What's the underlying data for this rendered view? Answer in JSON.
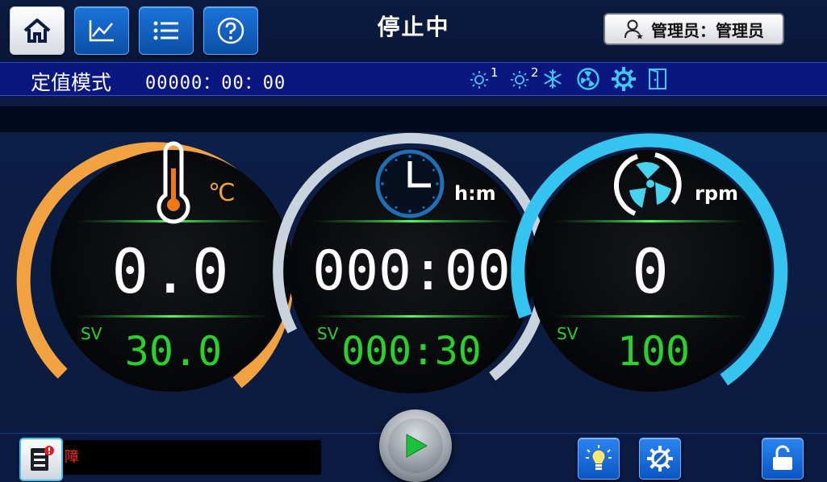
{
  "header": {
    "status": "停止中",
    "user_label": "管理员：管理员",
    "nav": [
      "home-icon",
      "chart-icon",
      "list-icon",
      "help-icon"
    ]
  },
  "mode_bar": {
    "mode": "定值模式",
    "timer": "00000：00：00",
    "light1_index": "1",
    "light2_index": "2"
  },
  "gauges": {
    "temperature": {
      "unit": "℃",
      "pv": "0.0",
      "sv_label": "SV",
      "sv": "30.0",
      "ring_color": "#f2a240"
    },
    "time": {
      "unit": "h:m",
      "pv": "000:00",
      "sv_label": "SV",
      "sv": "000:30",
      "ring_color": "#c9d3de"
    },
    "speed": {
      "unit": "rpm",
      "pv": "0",
      "sv_label": "SV",
      "sv": "100",
      "ring_color": "#35c4ef"
    }
  },
  "footer": {
    "alarm_text": "障",
    "buttons": [
      "alarm-log-icon",
      "play-icon",
      "light-bulb-icon",
      "settings-icon",
      "lock-icon"
    ]
  },
  "colors": {
    "digit_green": "#2ad12a",
    "accent_blue": "#1b73d8"
  }
}
